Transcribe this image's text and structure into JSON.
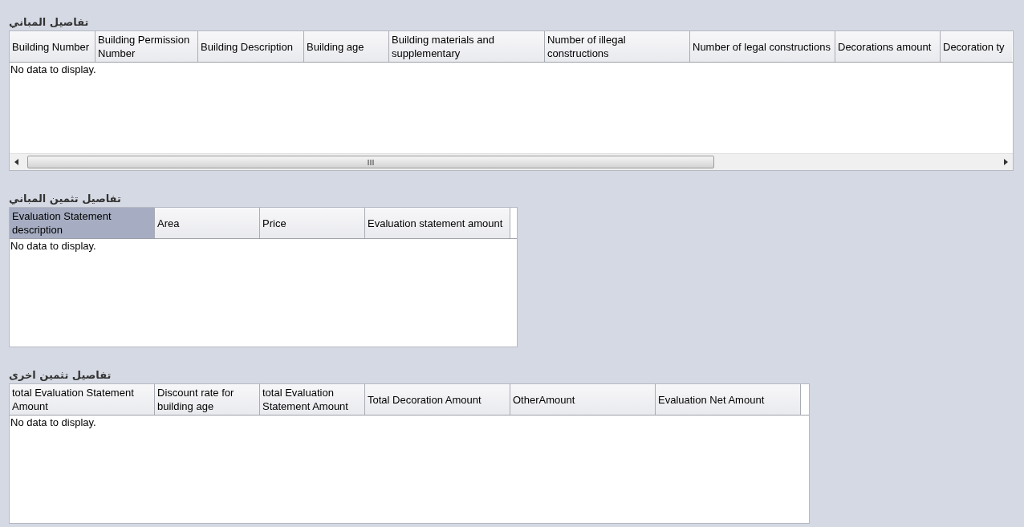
{
  "sections": [
    {
      "title": "تفاصيل المباني",
      "kind": "scrolling",
      "empty_text": "No data to display.",
      "columns": [
        {
          "label": "Building Number",
          "selected": false
        },
        {
          "label": "Building Permission Number",
          "selected": false
        },
        {
          "label": "Building Description",
          "selected": false
        },
        {
          "label": "Building age",
          "selected": false
        },
        {
          "label": "Building materials and supplementary",
          "selected": false
        },
        {
          "label": "Number of illegal constructions",
          "selected": false
        },
        {
          "label": "Number of legal constructions",
          "selected": false
        },
        {
          "label": "Decorations amount",
          "selected": false
        },
        {
          "label": "Decoration ty",
          "selected": false
        }
      ]
    },
    {
      "title": "تفاصيل تثمين المباني",
      "kind": "plain",
      "empty_text": "No data to display.",
      "columns": [
        {
          "label": "Evaluation Statement description",
          "selected": true
        },
        {
          "label": "Area",
          "selected": false
        },
        {
          "label": "Price",
          "selected": false
        },
        {
          "label": "Evaluation statement amount",
          "selected": false
        }
      ]
    },
    {
      "title": "تفاصيل تثمين اخرى",
      "kind": "plain",
      "empty_text": "No data to display.",
      "columns": [
        {
          "label": "total Evaluation Statement Amount",
          "selected": false
        },
        {
          "label": "Discount rate for building age",
          "selected": false
        },
        {
          "label": "total Evaluation Statement Amount",
          "selected": false
        },
        {
          "label": "Total Decoration Amount",
          "selected": false
        },
        {
          "label": "OtherAmount",
          "selected": false
        },
        {
          "label": "Evaluation Net Amount",
          "selected": false
        }
      ]
    }
  ]
}
